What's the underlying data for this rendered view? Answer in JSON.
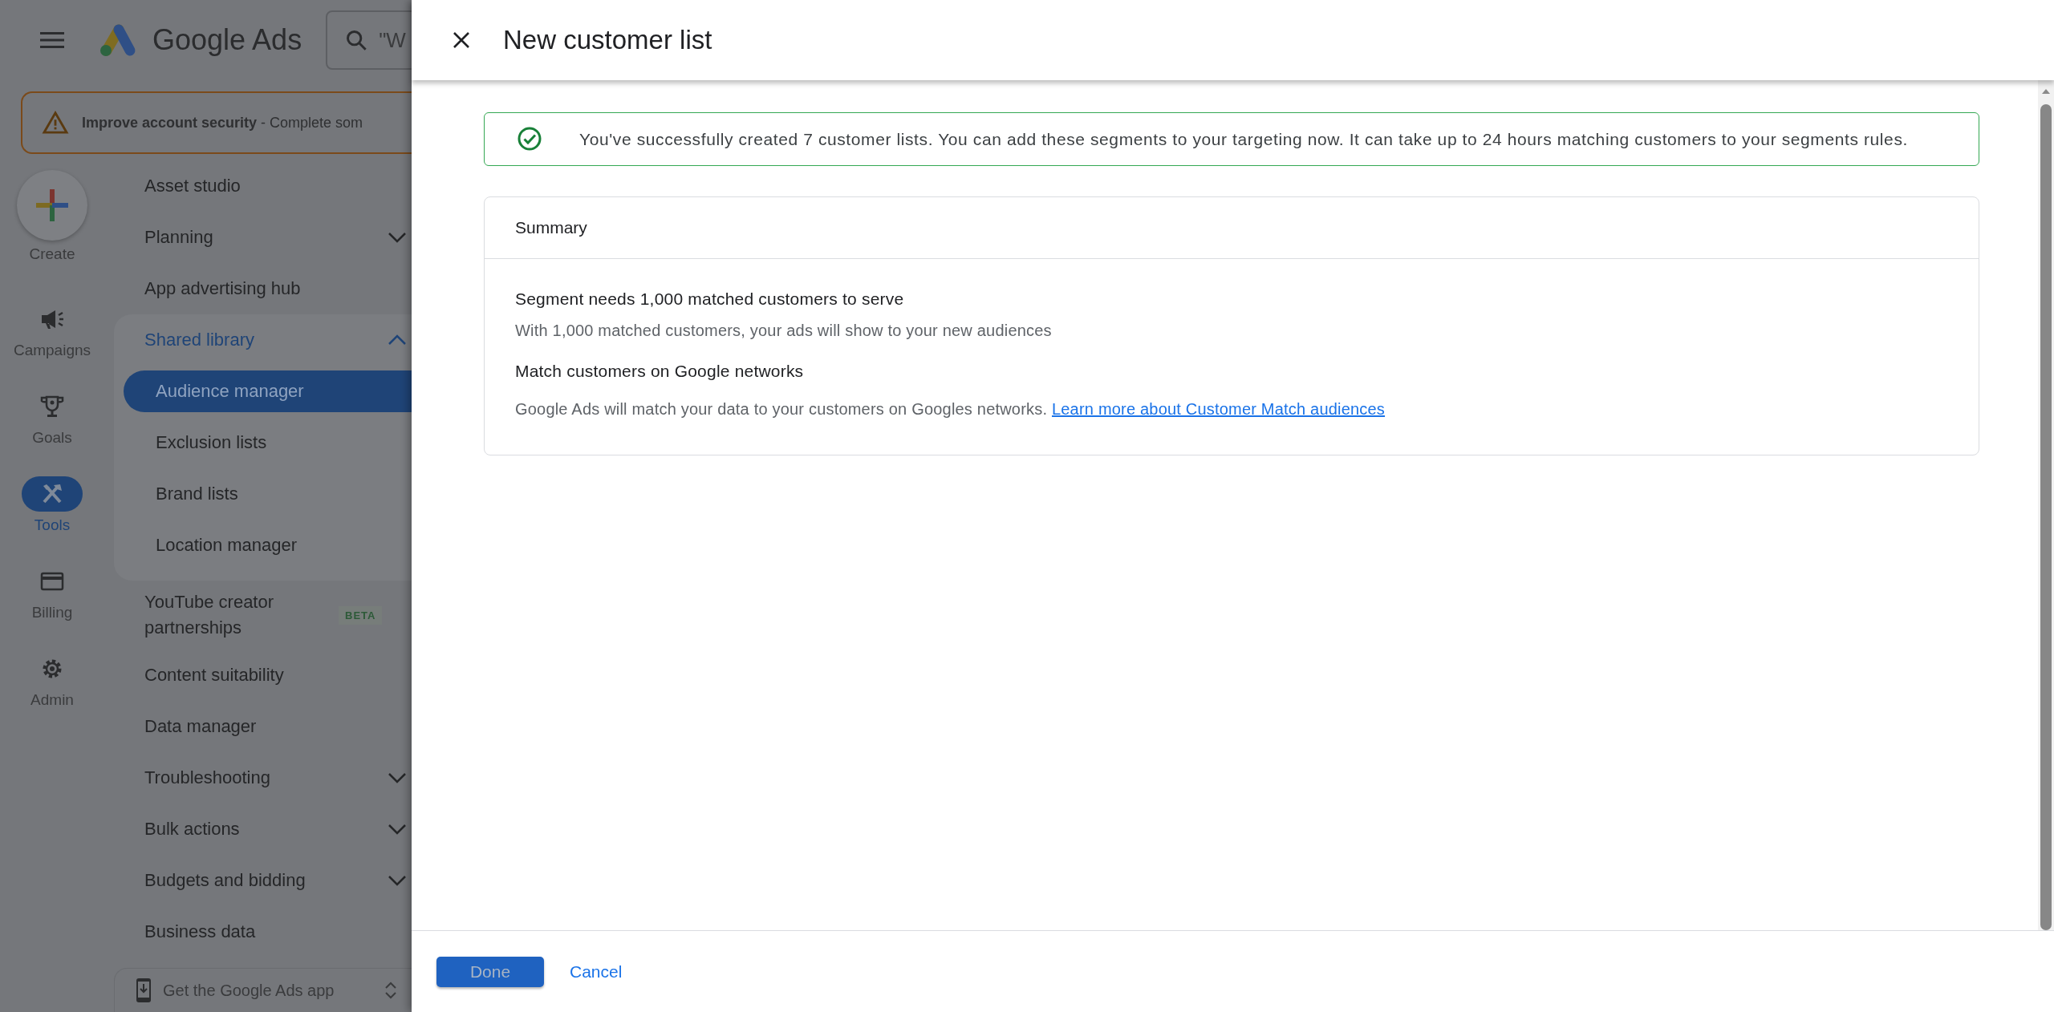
{
  "app": {
    "product_name": "Google Ads",
    "search": {
      "query": "\"W"
    },
    "alert": {
      "text": "**Improve account security** - Complete som"
    }
  },
  "rail": {
    "create_label": "Create",
    "items": [
      {
        "label": "Campaigns",
        "selected": false
      },
      {
        "label": "Goals",
        "selected": false
      },
      {
        "label": "Tools",
        "selected": true
      },
      {
        "label": "Billing",
        "selected": false
      },
      {
        "label": "Admin",
        "selected": false
      }
    ]
  },
  "nav": {
    "items": [
      {
        "label": "Asset studio",
        "selected": false
      },
      {
        "label": "Planning",
        "selected": false,
        "expanded": false
      },
      {
        "label": "App advertising hub",
        "selected": false
      },
      {
        "label": "Shared library",
        "selected": false,
        "expanded": true,
        "children": [
          {
            "label": "Audience manager",
            "selected": true
          },
          {
            "label": "Exclusion lists",
            "selected": false
          },
          {
            "label": "Brand lists",
            "selected": false
          },
          {
            "label": "Location manager",
            "selected": false
          }
        ]
      },
      {
        "label": "YouTube creator partnerships",
        "selected": false,
        "badge": "BETA"
      },
      {
        "label": "Content suitability",
        "selected": false
      },
      {
        "label": "Data manager",
        "selected": false
      },
      {
        "label": "Troubleshooting",
        "selected": false,
        "expanded": false
      },
      {
        "label": "Bulk actions",
        "selected": false,
        "expanded": false
      },
      {
        "label": "Budgets and bidding",
        "selected": false,
        "expanded": false
      },
      {
        "label": "Business data",
        "selected": false
      }
    ],
    "get_app": "Get the Google Ads app"
  },
  "panel": {
    "title": "New customer list",
    "success_message": "You've successfully created 7 customer lists. You can add these segments to your targeting now. It can take up to 24 hours matching customers to your segments rules.",
    "summary": {
      "title": "Summary",
      "sections": [
        {
          "heading": "Segment needs 1,000 matched customers to serve",
          "text": "With 1,000 matched customers, your ads will show to your new audiences"
        },
        {
          "heading": "Match customers on Google networks",
          "text": "Google Ads will match your data to your customers on Googles networks.",
          "link": "Learn more about Customer Match audiences"
        }
      ]
    },
    "buttons": {
      "primary": "Done",
      "secondary": "Cancel"
    }
  }
}
